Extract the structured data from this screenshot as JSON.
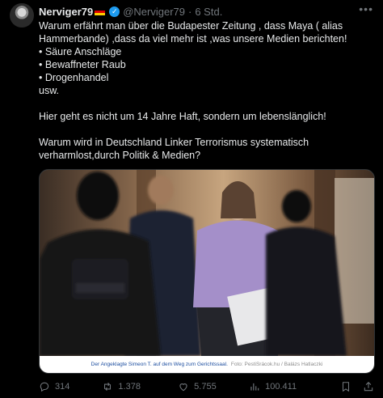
{
  "author": {
    "display_name": "Nerviger79",
    "handle": "@Nerviger79",
    "separator": "·",
    "time": "6 Std."
  },
  "tweet": {
    "line1": "Warum erfährt man über die Budapester Zeitung , dass Maya ( alias",
    "line2": "Hammerbande) ,dass da viel mehr ist ,was unsere Medien berichten!",
    "bullet1": "• Säure Anschläge",
    "bullet2": "• Bewaffneter Raub",
    "bullet3": "• Drogenhandel",
    "line_usw": "usw.",
    "paragraph2": "Hier geht es nicht um 14 Jahre Haft, sondern um lebenslänglich!",
    "paragraph3_line1": "Warum wird in Deutschland Linker Terrorismus systematisch",
    "paragraph3_line2": "verharmlost,durch Politik & Medien?"
  },
  "media": {
    "caption": "Der Angeklagte Simeon T. auf dem Weg zum Gerichtssaal.",
    "credit": "Foto: PestiSrácok.hu / Balázs Hatlaczki"
  },
  "actions": {
    "replies": "314",
    "reposts": "1.378",
    "likes": "5.755",
    "views": "100.411"
  },
  "icons": [
    "more-icon",
    "verified-icon",
    "reply-icon",
    "repost-icon",
    "like-icon",
    "views-icon",
    "bookmark-icon",
    "share-icon"
  ],
  "colors": {
    "background": "#000000",
    "text": "#e7e9ea",
    "muted": "#71767b",
    "verified": "#1d9bf0"
  }
}
